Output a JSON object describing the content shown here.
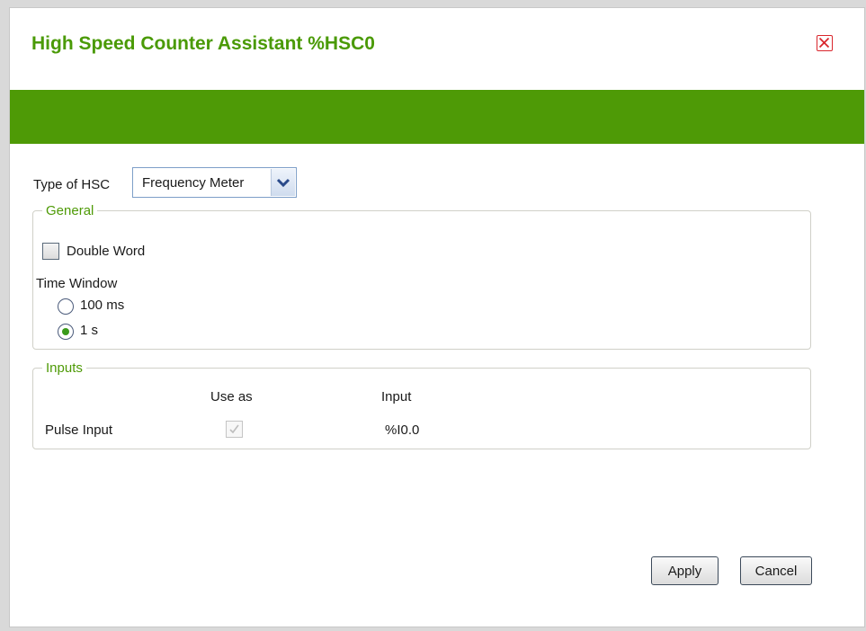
{
  "dialog": {
    "title": "High Speed Counter Assistant %HSC0",
    "close_icon": "close-icon",
    "colors": {
      "accent": "#4e9a06",
      "close": "#d9262c"
    }
  },
  "type_of_hsc": {
    "label": "Type of HSC",
    "selected": "Frequency Meter",
    "arrow_icon": "chevron-down-icon"
  },
  "general": {
    "legend": "General",
    "double_word": {
      "label": "Double Word",
      "checked": false
    },
    "time_window": {
      "label": "Time Window",
      "options": [
        {
          "label": "100 ms",
          "selected": false
        },
        {
          "label": "1 s",
          "selected": true
        }
      ]
    }
  },
  "inputs": {
    "legend": "Inputs",
    "columns": [
      "Use as",
      "Input"
    ],
    "rows": [
      {
        "name": "Pulse Input",
        "use_as": true,
        "input": "%I0.0"
      }
    ]
  },
  "buttons": {
    "apply": "Apply",
    "cancel": "Cancel"
  }
}
